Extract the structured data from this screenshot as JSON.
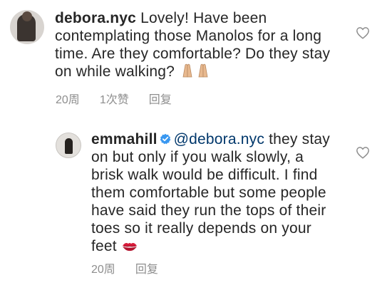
{
  "comments": [
    {
      "username": "debora.nyc",
      "text": "Lovely! Have been contemplating those Manolos for a long time. Are they comfortable? Do they stay on while walking?",
      "emoji": "🙏🏼🙏🏼",
      "time": "20周",
      "likes": "1次赞",
      "reply_label": "回复"
    },
    {
      "username": "emmahill",
      "verified": true,
      "mention": "@debora.nyc",
      "text": "they stay on but only if you walk slowly, a brisk walk would be difficult. I find them comfortable but some people have said they run the tops of their toes so it really depends on your feet",
      "emoji": "💋",
      "time": "20周",
      "reply_label": "回复"
    }
  ],
  "icons": {
    "like": "heart-outline-icon",
    "verified": "verified-badge-icon",
    "prayer_hands": "folded-hands-emoji",
    "kiss": "kiss-mark-emoji"
  },
  "colors": {
    "text": "#262626",
    "meta": "#8e8e8e",
    "mention": "#00376b",
    "verified": "#3897f0",
    "kiss": "#d81b3a"
  }
}
